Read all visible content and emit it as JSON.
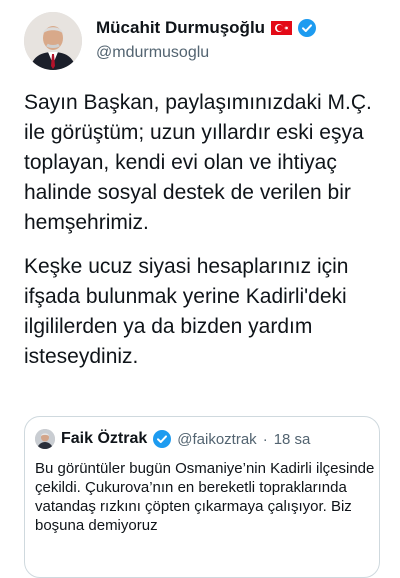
{
  "author": {
    "name": "Mücahit Durmuşoğlu",
    "handle": "@mdurmusoglu"
  },
  "tweet": {
    "paragraph_1": "Sayın Başkan, paylaşımınızdaki M.Ç. ile görüştüm; uzun yıllardır eski eşya toplayan, kendi evi olan ve ihtiyaç halinde sosyal destek de verilen bir hemşehrimiz.",
    "paragraph_2": "Keşke ucuz siyasi hesaplarınız için ifşada bulunmak yerine Kadirli'deki ilgililerden ya da bizden yardım isteseydiniz."
  },
  "quoted_tweet": {
    "name": "Faik Öztrak",
    "handle": "@faikoztrak",
    "separator": "·",
    "time": "18 sa",
    "text": "Bu görüntüler bugün Osmaniye’nin Kadirli ilçesinde çekildi. Çukurova’nın en bereketli topraklarında vatandaş rızkını çöpten çıkarmaya çalışıyor. Biz boşuna demiyoruz"
  },
  "colors": {
    "verified_badge": "#1d9bf0",
    "flag_red": "#e30a17",
    "secondary_text": "#536471",
    "border": "#cfd9de"
  },
  "icons": [
    "turkey-flag-icon",
    "verified-badge-icon"
  ]
}
